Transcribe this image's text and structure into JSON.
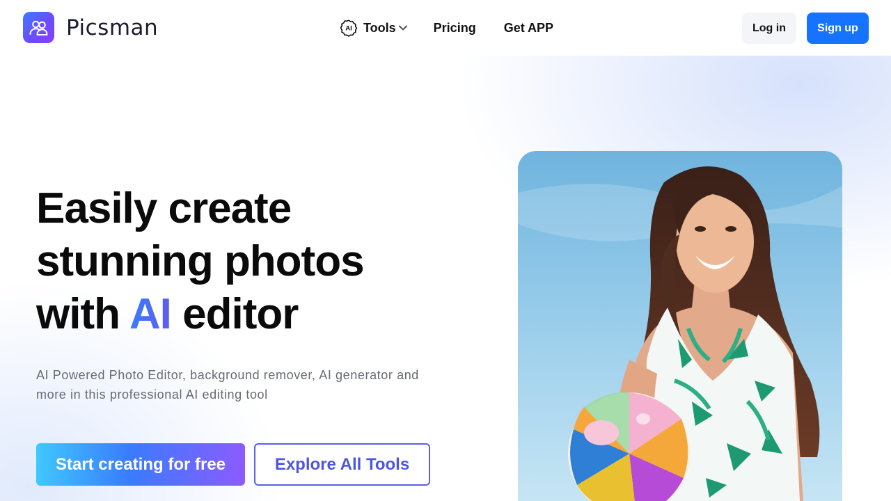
{
  "brand": {
    "name": "Picsman",
    "logo_icon": "users-icon"
  },
  "nav": {
    "tools": {
      "label": "Tools",
      "badge": "AI"
    },
    "pricing": "Pricing",
    "get_app": "Get APP"
  },
  "auth": {
    "login": "Log in",
    "signup": "Sign up"
  },
  "hero": {
    "title_line1": "Easily create",
    "title_line2": "stunning photos",
    "title_line3_pre": "with ",
    "title_line3_accent": "AI",
    "title_line3_post": " editor",
    "subtitle": "AI Powered Photo Editor, background remover, AI generator and more in this professional AI editing tool",
    "cta_primary": "Start creating for free",
    "cta_secondary": "Explore All Tools",
    "image_alt": "woman-holding-beach-ball"
  },
  "colors": {
    "accent_blue": "#1673ff",
    "accent_purple": "#8b5cff",
    "cyan": "#3fc8ff"
  }
}
